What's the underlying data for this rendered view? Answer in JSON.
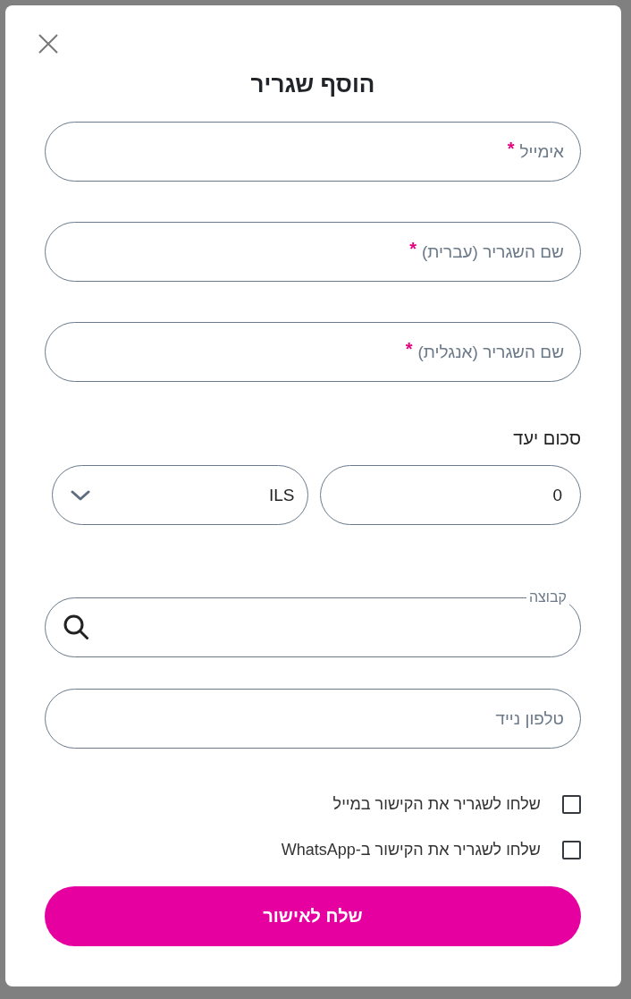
{
  "dialog": {
    "title": "הוסף שגריר"
  },
  "fields": [
    {
      "placeholder": "אימייל",
      "required_mark": "*"
    },
    {
      "placeholder": "שם השגריר (עברית)",
      "required_mark": "*"
    },
    {
      "placeholder": "שם השגריר (אנגלית)",
      "required_mark": "*"
    }
  ],
  "target_amount": {
    "label": "סכום יעד",
    "amount": "0",
    "currency": "ILS"
  },
  "group_field": {
    "label": "קבוצה"
  },
  "phone_field": {
    "placeholder": "טלפון נייד"
  },
  "checkboxes": [
    {
      "label": "שלחו לשגריר את הקישור במייל",
      "checked": false
    },
    {
      "label": "שלחו לשגריר את הקישור ב-WhatsApp",
      "checked": false
    }
  ],
  "submit_button": {
    "label": "שלח לאישור"
  }
}
